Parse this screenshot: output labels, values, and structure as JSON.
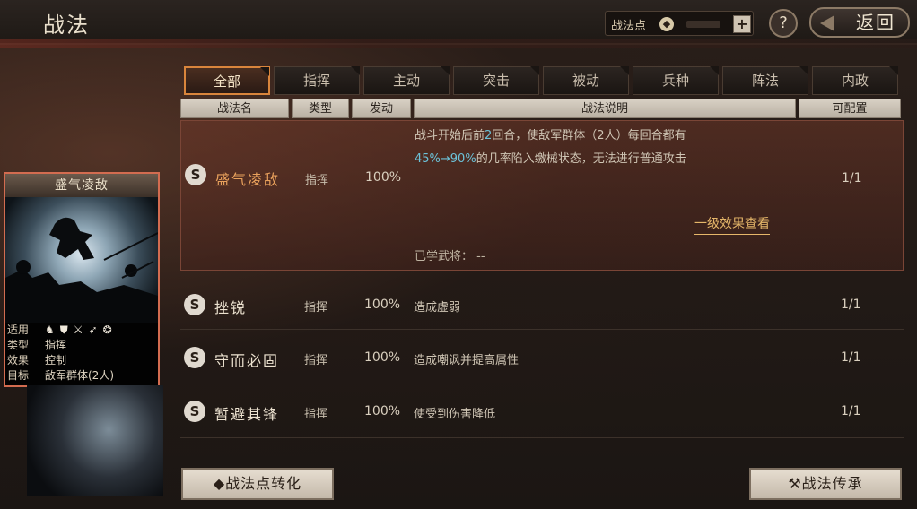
{
  "header": {
    "title": "战法",
    "points_label": "战法点",
    "points_value": "",
    "plus": "+",
    "help": "?",
    "back": "返回"
  },
  "tabs": [
    {
      "label": "全部",
      "active": true
    },
    {
      "label": "指挥",
      "active": false
    },
    {
      "label": "主动",
      "active": false
    },
    {
      "label": "突击",
      "active": false
    },
    {
      "label": "被动",
      "active": false
    },
    {
      "label": "兵种",
      "active": false
    },
    {
      "label": "阵法",
      "active": false
    },
    {
      "label": "内政",
      "active": false
    }
  ],
  "columns": {
    "name": "战法名",
    "type": "类型",
    "rate": "发动",
    "desc": "战法说明",
    "config": "可配置"
  },
  "rows": [
    {
      "badge": "S",
      "name": "盛气凌敌",
      "type": "指挥",
      "rate": "100%",
      "desc_line1_a": "战斗开始后前",
      "desc_line1_b": "2",
      "desc_line1_c": "回合，使敌军群体（2人）每回合都有",
      "desc_line2_a": "45%→90%",
      "desc_line2_b": "的几率陷入缴械状态，无法进行普通攻击",
      "config": "1/1",
      "effect_link": "一级效果查看",
      "learned": "已学武将： --"
    },
    {
      "badge": "S",
      "name": "挫锐",
      "type": "指挥",
      "rate": "100%",
      "desc": "造成虚弱",
      "config": "1/1"
    },
    {
      "badge": "S",
      "name": "守而必固",
      "type": "指挥",
      "rate": "100%",
      "desc": "造成嘲讽并提高属性",
      "config": "1/1"
    },
    {
      "badge": "S",
      "name": "暂避其锋",
      "type": "指挥",
      "rate": "100%",
      "desc": "使受到伤害降低",
      "config": "1/1"
    }
  ],
  "card": {
    "title": "盛气凌敌",
    "apply_label": "适用",
    "type_label": "类型",
    "type_value": "指挥",
    "effect_label": "效果",
    "effect_value": "控制",
    "target_label": "目标",
    "target_value": "敌军群体(2人)",
    "unit_icons": [
      "cavalry-icon",
      "shield-icon",
      "crossed-swords-icon",
      "bow-icon",
      "wheel-icon"
    ]
  },
  "buttons": {
    "convert": "战法点转化",
    "inherit": "战法传承"
  }
}
